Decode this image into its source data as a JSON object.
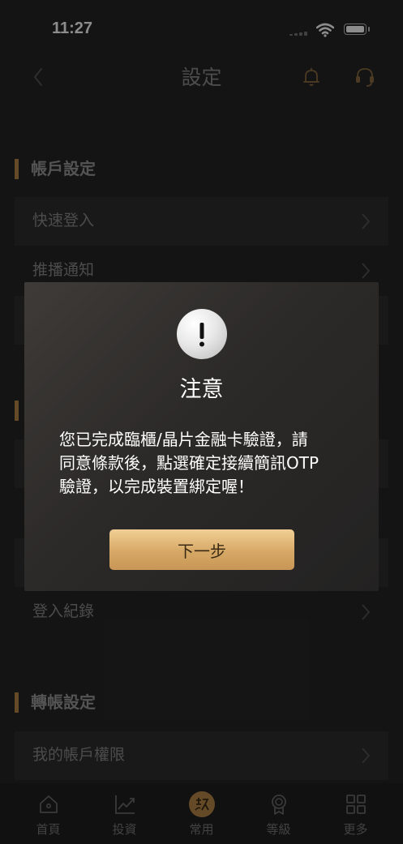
{
  "status_bar": {
    "time": "11:27"
  },
  "nav": {
    "title": "設定"
  },
  "sections": [
    {
      "title": "帳戶設定",
      "items": [
        {
          "label": "快速登入"
        },
        {
          "label": "推播通知"
        }
      ]
    },
    {
      "hidden_items": [
        {
          "label": "登入紀錄"
        }
      ]
    },
    {
      "title": "轉帳設定",
      "items": [
        {
          "label": "我的帳戶權限"
        }
      ]
    }
  ],
  "dialog": {
    "title": "注意",
    "message_lines": [
      "您已完成臨櫃/晶片金融卡驗證，請",
      "同意條款後，點選確定接續簡訊OTP",
      "驗證，以完成裝置綁定喔！"
    ],
    "button_label": "下一步"
  },
  "tab_bar": {
    "tabs": [
      {
        "label": "首頁",
        "icon": "home-icon"
      },
      {
        "label": "投資",
        "icon": "chart-icon"
      },
      {
        "label": "常用",
        "icon": "favorite-icon"
      },
      {
        "label": "等級",
        "icon": "badge-icon"
      },
      {
        "label": "更多",
        "icon": "grid-icon"
      }
    ],
    "active_index": 2
  },
  "colors": {
    "accent_gold": "#b8874a",
    "button_gold": "#d6a866",
    "background": "#262626"
  }
}
